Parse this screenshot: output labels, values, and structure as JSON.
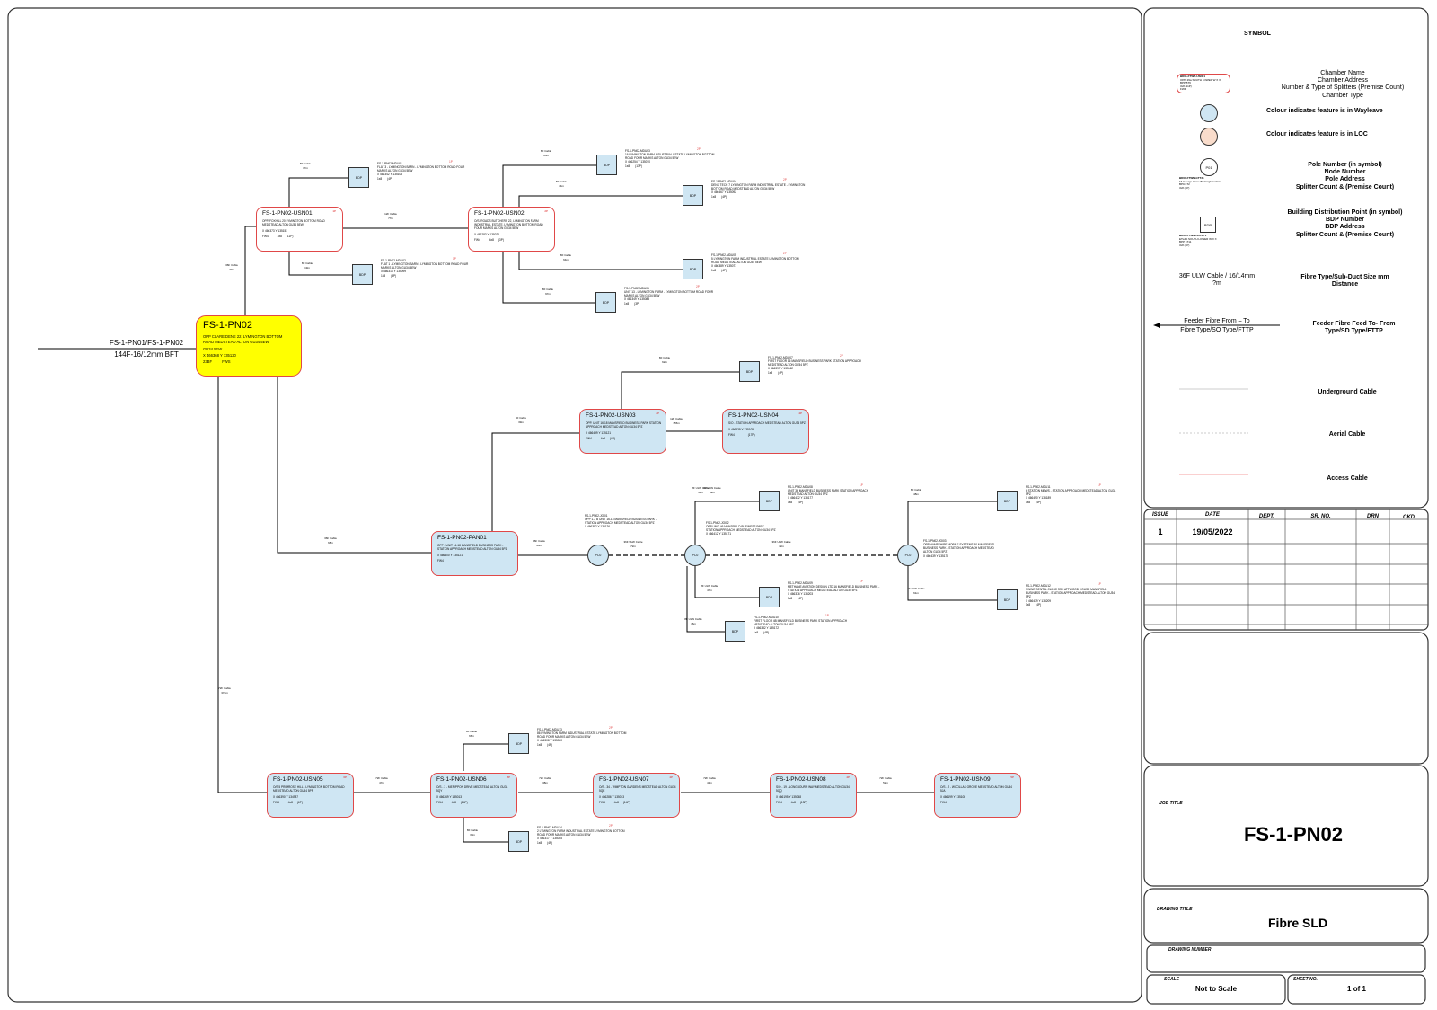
{
  "feeder": {
    "label1": "FS-1-PN01/FS-1-PN02",
    "label2": "144F-16/12mm BFT"
  },
  "main_node": {
    "name": "FS-1-PN02",
    "address": "OPP CLARE DENE 22, LYMINGTON BOTTOM ROAD MEDSTEAD ALTON GU34 5EW",
    "postcode": "GU34 5EW",
    "coords": "X 466368 Y 135120",
    "count": "23BF",
    "type": "FWS"
  },
  "colors": {
    "wayleave": "#cfe6f3",
    "loc": "#f9dccb",
    "main_fill": "#ffff00",
    "node_border": "#e04848",
    "access_cable": "#f08080"
  },
  "chambers": [
    {
      "key": "usn01",
      "name": "FS-1-PN02-USN01",
      "addr": "OPP. FOXHILL 20 LYMINGTON BOTTOM ROAD MEDSTEAD ALTON GU34 5EW",
      "coords": "X 466373 Y 135151",
      "type": "FW4",
      "split": "4x8",
      "count": "(11P)",
      "tag": "1P"
    },
    {
      "key": "usn02",
      "name": "FS-1-PN02-USN02",
      "addr": "O/S. ROADS BUTCHERS 22, LYMINGTON FARM INDUSTRIAL ESTATE, LYMINGTON BOTTOM ROAD FOUR MARKS ALTON GU34 5EW",
      "coords": "X 466283 Y 135076",
      "type": "FW4",
      "split": "4x8",
      "count": "(3P)",
      "tag": "2P"
    },
    {
      "key": "usn03",
      "name": "FS-1-PN02-USN03",
      "addr": "OPP. UNIT 16-18 MANSFIELD BUSINESS PARK STATION APPROACH MEDSTEAD ALTON GU34 5PZ",
      "coords": "X 466499 Y 135121",
      "type": "FW4",
      "split": "4x8",
      "count": "(4P)",
      "tag": "2P"
    },
    {
      "key": "usn04",
      "name": "FS-1-PN02-USN04",
      "addr": "S/O - STATION APPROACH MEDSTEAD ALTON GU34 5PZ",
      "coords": "X 466439 Y 135105",
      "type": "FW4",
      "split": "",
      "count": "(17P)",
      "tag": "4P"
    },
    {
      "key": "pan01",
      "name": "FS-1-PN02-PAN01",
      "addr": "OPP - UNIT 14-18 MANSFIELD BUSINESS PARK - STATION APPROACH MEDSTEAD ALTON GU34 5PZ",
      "coords": "X 466400 Y 135121",
      "type": "FW4",
      "split": "",
      "count": "",
      "tag": ""
    },
    {
      "key": "usn05",
      "name": "FS-1-PN02-USN05",
      "addr": "O/S 5 PRIMROSE HILL - LYMINGTON BOTTOM ROAD MEDSTEAD ALTON GU34 5PR",
      "coords": "X 466390 Y 134987",
      "type": "FW4",
      "split": "4x8",
      "count": "(6P)",
      "tag": "6P"
    },
    {
      "key": "usn06",
      "name": "FS-1-PN02-USN06",
      "addr": "O/S - 3 - MERIPPON DRIVE MEDSTEAD ALTON GU34 5QY",
      "coords": "X 466269 Y 135013",
      "type": "FW4",
      "split": "4x8",
      "count": "(14P)",
      "tag": "8P"
    },
    {
      "key": "usn07",
      "name": "FS-1-PN02-USN07",
      "addr": "O/S - 34 - WIMPTON GARDENS MEDSTEAD ALTON GU34 5QE",
      "coords": "X 466286 Y 135013",
      "type": "FW4",
      "split": "4x8",
      "count": "(14P)",
      "tag": "4P"
    },
    {
      "key": "usn08",
      "name": "FS-1-PN02-USN08",
      "addr": "S/O - 19 - LONGBOURN WAY MEDSTEAD ALTON GU34 5QQ",
      "coords": "X 466195 Y 135048",
      "type": "FW4",
      "split": "4x8",
      "count": "(13P)",
      "tag": "4P"
    },
    {
      "key": "usn09",
      "name": "FS-1-PN02-USN09",
      "addr": "O/S - 2 - WOOLLAS GROVE MEDSTEAD ALTON GU34 5JA",
      "coords": "X 466199 Y 135108",
      "type": "FW4",
      "split": "",
      "count": "",
      "tag": "5P"
    }
  ],
  "bdps": [
    {
      "key": "b1",
      "name": "FS-1-PN02-MDU01",
      "addr": "FLAT 3 - LYMINGTON BARN - LYMINGTON BOTTOM ROAD FOUR MARKS ALTON GU34 5EW",
      "coords": "X 466342 Y 135108",
      "split": "1x8",
      "count": "(4P)",
      "tag": "1P"
    },
    {
      "key": "b2",
      "name": "FS-1-PN02-MDU02",
      "addr": "FLAT 1 - LYMINGTON BARN - LYMINGTON BOTTOM ROAD FOUR MARKS ALTON GU34 5EW",
      "coords": "X 466314 Y 135099",
      "split": "1x8",
      "count": "(3P)",
      "tag": "1P"
    },
    {
      "key": "b3",
      "name": "FS-1-PN02-MDU03",
      "addr": "16 LYMINGTON FARM INDUSTRIAL ESTATE LYMINGTON BOTTOM ROAD FOUR MARKS ALTON GU34 5EW",
      "coords": "X 466254 Y 135070",
      "split": "1x8",
      "count": "(13P)",
      "tag": "2P"
    },
    {
      "key": "b4",
      "name": "FS-1-PN02-MDU04",
      "addr": "DENS TECH 7 LYMINGTON FARM INDUSTRIAL ESTATE - LYMINGTON BOTTOM ROAD MEDSTEAD ALTON GU34 5EW",
      "coords": "X 466467 Y 135092",
      "split": "1x8",
      "count": "(4P)",
      "tag": "2P"
    },
    {
      "key": "b5",
      "name": "FS-1-PN02-MDU05",
      "addr": "5 LYMINGTON FARM INDUSTRIAL ESTATE LYMINGTON BOTTOM ROAD MEDSTEAD ALTON GU34 5EW",
      "coords": "X 466389 Y 135071",
      "split": "1x8",
      "count": "(4P)",
      "tag": "2P"
    },
    {
      "key": "b6",
      "name": "FS-1-PN02-MDU06",
      "addr": "UNIT 13 - LYMINGTON FARM - LYMINGTON BOTTOM ROAD FOUR MARKS ALTON GU34 5EW",
      "coords": "X 466349 Y 135083",
      "split": "1x8",
      "count": "(3P)",
      "tag": "2P"
    },
    {
      "key": "b7",
      "name": "FS-1-PN02-MDU07",
      "addr": "FIRST FLOOR 16 MANSFIELD BUSINESS PARK STATION APPROACH MEDSTEAD ALTON GU34 5PZ",
      "coords": "X 466399 Y 135162",
      "split": "1x8",
      "count": "(4P)",
      "tag": "2P"
    },
    {
      "key": "b8",
      "name": "FS-1-PN02-MDU08",
      "addr": "UNIT 36 MANSFIELD BUSINESS PARK STATION APPROACH MEDSTEAD ALTON GU34 5PZ",
      "coords": "X 466432 Y 135177",
      "split": "1x8",
      "count": "(4P)",
      "tag": "1P"
    },
    {
      "key": "b9",
      "name": "FS-1-PN02-MDU09",
      "addr": "METHANE AVIATION DESIGN LTD 16 MANSFIELD BUSINESS PARK - STATION APPROACH MEDSTEAD ALTON GU34 5PZ",
      "coords": "X 466376 Y 135203",
      "split": "1x8",
      "count": "(4P)",
      "tag": "1P"
    },
    {
      "key": "b10",
      "name": "FS-1-PN02-MDU10",
      "addr": "FIRST FLOOR 4B MANSFIELD BUSINESS PARK STATION APPROACH MEDSTEAD ALTON GU34 5PZ",
      "coords": "X 466382 Y 135172",
      "split": "1x8",
      "count": "(4P)",
      "tag": "1P"
    },
    {
      "key": "b11",
      "name": "FS-1-PN02-MDU11",
      "addr": "6 STATION MEWS - STATION APPROACH MEDSTEAD ALTON GU34 5PZ",
      "coords": "X 466490 Y 135189",
      "split": "1x8",
      "count": "(4P)",
      "tag": "1P"
    },
    {
      "key": "b12",
      "name": "FS-1-PN02-MDU12",
      "addr": "SWINE DENTAL CLINIC SSH ATTWOOD HOUSE MANSFIELD BUSINESS PARK - STATION APPROACH MEDSTEAD ALTON GU34 5PZ",
      "coords": "X 466439 Y 135209",
      "split": "1x8",
      "count": "(4P)",
      "tag": "1P"
    },
    {
      "key": "b13",
      "name": "FS-1-PN02-MDU13",
      "addr": "86 LYMINGTON FARM INDUSTRIAL ESTATE LYMINGTON BOTTOM ROAD FOUR MARKS ALTON GU34 5EW",
      "coords": "X 466308 Y 135020",
      "split": "1x8",
      "count": "(4P)",
      "tag": "2P"
    },
    {
      "key": "b14",
      "name": "FS-1-PN02-MDU14",
      "addr": "2 LYMINGTON FARM INDUSTRIAL ESTATE LYMINGTON BOTTOM ROAD FOUR MARKS ALTON GU34 5EW",
      "coords": "X 466317 Y 135045",
      "split": "1x8",
      "count": "(4P)",
      "tag": "2P"
    }
  ],
  "poles": [
    {
      "key": "p1",
      "name": "FS-1-PN02-JOI01",
      "addr": "OPP 1-3 B UNIT 16-18 MANSFIELD BUSINESS PARK - STATION APPROACH MEDSTEAD ALTON GU34 5PZ",
      "coords": "X 466392 Y 135126",
      "label": "POJ"
    },
    {
      "key": "p2",
      "name": "FS-1-PN02-JOI02",
      "addr": "OPP UNIT 46 MANSFIELD BUSINESS PARK - STATION APPROACH MEDSTEAD ALTON GU34 5PZ",
      "coords": "X 466412 Y 135171",
      "label": "POJ"
    },
    {
      "key": "p3",
      "name": "FS-1-PN02-JOI03",
      "addr": "OPP HAMPSHIRE MOBILE SYSTEMS 50 MANSFIELD BUSINESS PARK - STATION APPROACH MEDSTEAD ALTON GU34 5PZ",
      "coords": "X 466439 Y 135178",
      "label": "POJ"
    }
  ],
  "cable_labels": [
    {
      "key": "c1",
      "a": "8F Cable",
      "b": "17m"
    },
    {
      "key": "c2",
      "a": "8F Cable",
      "b": "19m"
    },
    {
      "key": "c3",
      "a": "12F Cable",
      "b": "77m"
    },
    {
      "key": "c4",
      "a": "36F Cable",
      "b": "73m"
    },
    {
      "key": "c5",
      "a": "8F Cable",
      "b": "65m"
    },
    {
      "key": "c6",
      "a": "8F Cable",
      "b": "44m"
    },
    {
      "key": "c7",
      "a": "8F Cable",
      "b": "64m"
    },
    {
      "key": "c8",
      "a": "8F Cable",
      "b": "97m"
    },
    {
      "key": "c9",
      "a": "8F Cable",
      "b": "62m"
    },
    {
      "key": "c10",
      "a": "8F Cable",
      "b": "39m"
    },
    {
      "key": "c11",
      "a": "12F Cable",
      "b": "155m"
    },
    {
      "key": "c12",
      "a": "36F Cable",
      "b": "68m"
    },
    {
      "key": "c13",
      "a": "36F Cable",
      "b": "45m"
    },
    {
      "key": "c14",
      "a": "8F ULW Cable",
      "b": "54m"
    },
    {
      "key": "c15",
      "a": "36F ULW Cable",
      "b": "72m"
    },
    {
      "key": "c16",
      "a": "36F ULW Cable",
      "b": "72m"
    },
    {
      "key": "c17",
      "a": "8F ULW Cable",
      "b": "47m"
    },
    {
      "key": "c18",
      "a": "8F ULW Cable",
      "b": "46m"
    },
    {
      "key": "c19",
      "a": "8F Cable",
      "b": "48m"
    },
    {
      "key": "c20",
      "a": "8F ULW Cable",
      "b": "61m"
    },
    {
      "key": "c21",
      "a": "8F ULW Cable",
      "b": "52m"
    },
    {
      "key": "c22",
      "a": "72F Cable",
      "b": "378m"
    },
    {
      "key": "c23",
      "a": "8F Cable",
      "b": "66m"
    },
    {
      "key": "c24",
      "a": "8F Cable",
      "b": "39m"
    },
    {
      "key": "c25",
      "a": "72F Cable",
      "b": "47m"
    },
    {
      "key": "c26",
      "a": "72F Cable",
      "b": "38m"
    },
    {
      "key": "c27",
      "a": "72F Cable",
      "b": "41m"
    },
    {
      "key": "c28",
      "a": "72F Cable",
      "b": "52m"
    }
  ],
  "legend": {
    "title": "SYMBOL",
    "chamber_lines": [
      "Chamber Name",
      "Chamber Address",
      "Number & Type of Splitters (Premise Count)",
      "Chamber Type"
    ],
    "chamber_sample": [
      "BD01-FTWN-USN01",
      "OPP. 29a SOUTH LOWER W X X",
      "BPP 5T6",
      "3x8     (11P)",
      "FW4"
    ],
    "wayleave": "Colour indicates feature is in Wayleave",
    "loc": "Colour indicates feature is in LOC",
    "pole_label": "P01",
    "pole_lines": [
      "Pole Number (in symbol)",
      "Node Number",
      "Pole Address",
      "Splitter Count & (Premise Count)"
    ],
    "pole_sample": [
      "BD01-FTWN-GTT31",
      "16 George Close Buckinghamshire",
      "BP0-5T2",
      "3x8     (4P)"
    ],
    "bdp_label": "BDP",
    "bdp_lines": [
      "Building Distribution Point (in symbol)",
      "BDP Number",
      "BDP Address",
      "Splitter Count & (Premise Count)"
    ],
    "bdp_sample": [
      "BD01-FTWN-UNT01 1",
      "ETwFlt SOUTH LOWER W X X",
      "BPP 5T11",
      "3x8     (4P)"
    ],
    "fibre_sample_1": "36F ULW Cable / 16/14mm",
    "fibre_sample_2": "?m",
    "fibre_lines": [
      "Fibre Type/Sub-Duct Size mm",
      "Distance"
    ],
    "feeder_sample_1": "Feeder Fibre From – To",
    "feeder_sample_2": "Fibre Type/SO Type/FTTP",
    "feeder_lines": [
      "Feeder Fibre Feed To- From",
      "Type/SD Type/FTTP"
    ],
    "underground": "Underground Cable",
    "aerial": "Aerial Cable",
    "access": "Access Cable"
  },
  "issue_table": {
    "headers": [
      "ISSUE",
      "DATE",
      "DEPT.",
      "SR. NO.",
      "DRN",
      "CKD"
    ],
    "rows": [
      [
        "1",
        "19/05/2022",
        "",
        "",
        "",
        ""
      ]
    ]
  },
  "title_block": {
    "job_title_label": "JOB TITLE",
    "job_title": "FS-1-PN02",
    "drawing_title_label": "DRAWING TITLE",
    "drawing_title": "Fibre SLD",
    "drawing_number_label": "DRAWING NUMBER",
    "drawing_number": "",
    "scale_label": "SCALE",
    "scale": "Not to Scale",
    "sheet_label": "SHEET NO.",
    "sheet": "1 of 1"
  }
}
